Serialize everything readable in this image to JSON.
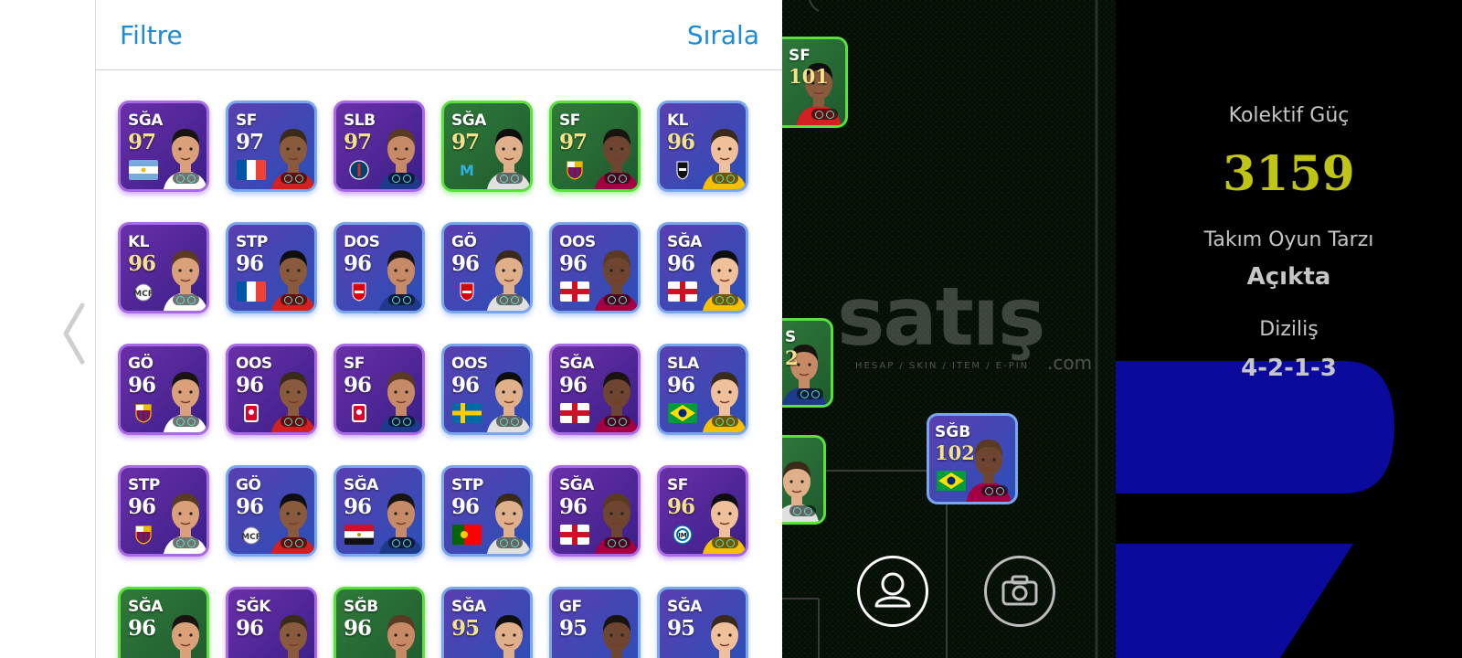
{
  "header": {
    "filter_label": "Filtre",
    "sort_label": "Sırala"
  },
  "theme": {
    "accent": "#1e8ad6",
    "collective_color": "#c0c414"
  },
  "cards": [
    {
      "pos": "SĞA",
      "rating": "97",
      "frame": "purple",
      "rcolor": "#f3e28a",
      "badge": "flag-argentina"
    },
    {
      "pos": "SF",
      "rating": "97",
      "frame": "blue",
      "rcolor": "#ffffff",
      "badge": "flag-france"
    },
    {
      "pos": "SLB",
      "rating": "97",
      "frame": "purple",
      "rcolor": "#f3e28a",
      "badge": "club-psg"
    },
    {
      "pos": "SĞA",
      "rating": "97",
      "frame": "green",
      "rcolor": "#f3e28a",
      "badge": "club-marseille"
    },
    {
      "pos": "SF",
      "rating": "97",
      "frame": "green",
      "rcolor": "#f3e28a",
      "badge": "club-barcelona"
    },
    {
      "pos": "KL",
      "rating": "96",
      "frame": "blue",
      "rcolor": "#f3e28a",
      "badge": "club-besiktas"
    },
    {
      "pos": "KL",
      "rating": "96",
      "frame": "purple",
      "rcolor": "#f3e28a",
      "badge": "club-real-madrid"
    },
    {
      "pos": "STP",
      "rating": "96",
      "frame": "blue",
      "rcolor": "#ffffff",
      "badge": "flag-france"
    },
    {
      "pos": "DOS",
      "rating": "96",
      "frame": "blue",
      "rcolor": "#ffffff",
      "badge": "club-arsenal"
    },
    {
      "pos": "GÖ",
      "rating": "96",
      "frame": "blue",
      "rcolor": "#ffffff",
      "badge": "club-arsenal"
    },
    {
      "pos": "OOS",
      "rating": "96",
      "frame": "blue",
      "rcolor": "#ffffff",
      "badge": "flag-england"
    },
    {
      "pos": "SĞA",
      "rating": "96",
      "frame": "blue",
      "rcolor": "#ffffff",
      "badge": "flag-england"
    },
    {
      "pos": "GÖ",
      "rating": "96",
      "frame": "purple",
      "rcolor": "#ffffff",
      "badge": "club-barcelona"
    },
    {
      "pos": "OOS",
      "rating": "96",
      "frame": "purple",
      "rcolor": "#ffffff",
      "badge": "club-bayern"
    },
    {
      "pos": "SF",
      "rating": "96",
      "frame": "purple",
      "rcolor": "#ffffff",
      "badge": "club-bayern"
    },
    {
      "pos": "OOS",
      "rating": "96",
      "frame": "blue",
      "rcolor": "#ffffff",
      "badge": "flag-sweden"
    },
    {
      "pos": "SĞA",
      "rating": "96",
      "frame": "purple",
      "rcolor": "#ffffff",
      "badge": "flag-england"
    },
    {
      "pos": "SLA",
      "rating": "96",
      "frame": "blue",
      "rcolor": "#ffffff",
      "badge": "flag-brazil"
    },
    {
      "pos": "STP",
      "rating": "96",
      "frame": "purple",
      "rcolor": "#ffffff",
      "badge": "club-barcelona"
    },
    {
      "pos": "GÖ",
      "rating": "96",
      "frame": "blue",
      "rcolor": "#ffffff",
      "badge": "club-real-madrid"
    },
    {
      "pos": "SĞA",
      "rating": "96",
      "frame": "blue",
      "rcolor": "#ffffff",
      "badge": "flag-egypt"
    },
    {
      "pos": "STP",
      "rating": "96",
      "frame": "blue",
      "rcolor": "#ffffff",
      "badge": "flag-portugal"
    },
    {
      "pos": "SĞA",
      "rating": "96",
      "frame": "purple",
      "rcolor": "#ffffff",
      "badge": "flag-england"
    },
    {
      "pos": "SF",
      "rating": "96",
      "frame": "purple",
      "rcolor": "#f3e28a",
      "badge": "club-inter"
    },
    {
      "pos": "SĞA",
      "rating": "96",
      "frame": "green",
      "rcolor": "#ffffff",
      "badge": "none"
    },
    {
      "pos": "SĞK",
      "rating": "96",
      "frame": "purple",
      "rcolor": "#ffffff",
      "badge": "none"
    },
    {
      "pos": "SĞB",
      "rating": "96",
      "frame": "green",
      "rcolor": "#ffffff",
      "badge": "none"
    },
    {
      "pos": "SĞA",
      "rating": "95",
      "frame": "blue",
      "rcolor": "#f3e28a",
      "badge": "none"
    },
    {
      "pos": "GF",
      "rating": "95",
      "frame": "blue",
      "rcolor": "#ffffff",
      "badge": "none"
    },
    {
      "pos": "SĞA",
      "rating": "95",
      "frame": "blue",
      "rcolor": "#ffffff",
      "badge": "none"
    }
  ],
  "field": {
    "watermark_main": "satış",
    "watermark_sub": "HESAP / SKIN / ITEM / E-PIN",
    "watermark_dom": ".com",
    "pitch_cards": [
      {
        "pos": "SF",
        "rating": "101"
      },
      {
        "pos": "S",
        "rating": "2"
      },
      {
        "pos": "",
        "rating": ""
      },
      {
        "pos": "SĞB",
        "rating": "102"
      }
    ]
  },
  "stats": {
    "collective_label": "Kolektif Güç",
    "collective_value": "3159",
    "style_label": "Takım Oyun Tarzı",
    "style_value": "Açıkta",
    "formation_label": "Diziliş",
    "formation_value": "4-2-1-3"
  }
}
